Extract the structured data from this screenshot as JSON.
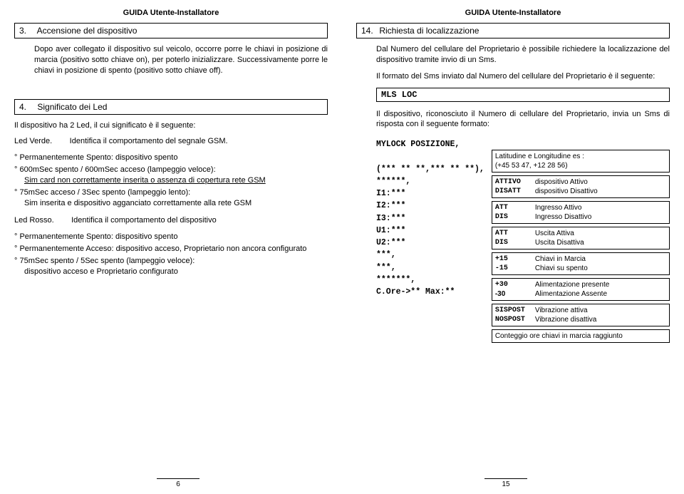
{
  "header": "GUIDA Utente-Installatore",
  "left": {
    "sec3": {
      "num": "3.",
      "title": "Accensione del dispositivo"
    },
    "p3": "Dopo aver collegato il dispositivo sul veicolo, occorre porre le chiavi in posizione di marcia (positivo sotto chiave on), per poterlo inizializzare. Successivamente porre le chiavi in posizione di spento (positivo sotto chiave off).",
    "sec4": {
      "num": "4.",
      "title": "Significato dei Led"
    },
    "p4a": "Il dispositivo ha 2 Led, il cui significato è il seguente:",
    "p4b_lead": "Led Verde.",
    "p4b_rest": "Identifica il comportamento del segnale GSM.",
    "green": {
      "i1": "Permanentemente Spento: dispositivo spento",
      "i2a": "600mSec spento / 600mSec acceso (lampeggio veloce):",
      "i2b_u": "Sim card non correttamente inserita o assenza di copertura rete GSM",
      "i3a": "75mSec acceso / 3Sec spento (lampeggio lento):",
      "i3b": "Sim inserita e dispositivo agganciato correttamente alla rete GSM"
    },
    "p4c_lead": "Led Rosso.",
    "p4c_rest": "Identifica il comportamento del dispositivo",
    "red": {
      "i1": "Permanentemente Spento: dispositivo spento",
      "i2": "Permanentemente Acceso: dispositivo acceso, Proprietario non ancora configurato",
      "i3a": "75mSec spento / 5Sec spento (lampeggio veloce):",
      "i3b": "dispositivo acceso e Proprietario configurato"
    },
    "page": "6"
  },
  "right": {
    "sec14": {
      "num": "14.",
      "title": "Richiesta di localizzazione"
    },
    "p14a": "Dal Numero del cellulare del Proprietario è possibile richiedere la localizzazione del dispositivo tramite invio di un Sms.",
    "p14b": "Il formato del Sms inviato dal Numero del cellulare del Proprietario è il seguente:",
    "cmd": "MLS LOC",
    "p14c": "Il dispositivo, riconosciuto il Numero di cellulare del Proprietario, invia un Sms di risposta con il seguente formato:",
    "sms": "MYLOCK POSIZIONE,\n\n(*** ** **,*** ** **),\n******,\nI1:***\nI2:***\nI3:***\nU1:***\nU2:***\n***,\n***,\n*******,\nC.Ore->** Max:**",
    "boxes": {
      "latlon": {
        "l1": "Latitudine e Longitudine es :",
        "l2": "(+45 53 47, +12 28 56)"
      },
      "attivo": {
        "k1": "ATTIVO",
        "v1": "dispositivo Attivo",
        "k2": "DISATT",
        "v2": "dispositivo Disattivo"
      },
      "ing": {
        "k1": "ATT",
        "v1": "Ingresso Attivo",
        "k2": "DIS",
        "v2": "Ingresso Disattivo"
      },
      "usc": {
        "k1": "ATT",
        "v1": "Uscita Attiva",
        "k2": "DIS",
        "v2": "Uscita Disattiva"
      },
      "chiavi": {
        "k1": "+15",
        "v1": "Chiavi in Marcia",
        "k2": "-15",
        "v2": "Chiavi su spento"
      },
      "alim": {
        "k1": "+30",
        "v1": "Alimentazione presente",
        "k2": "-30",
        "v2": "Alimentazione Assente"
      },
      "vib": {
        "k1": "SISPOST",
        "v1": "Vibrazione attiva",
        "k2": "NOSPOST",
        "v2": "Vibrazione disattiva"
      },
      "ore": "Conteggio ore chiavi in marcia raggiunto"
    },
    "page": "15"
  }
}
